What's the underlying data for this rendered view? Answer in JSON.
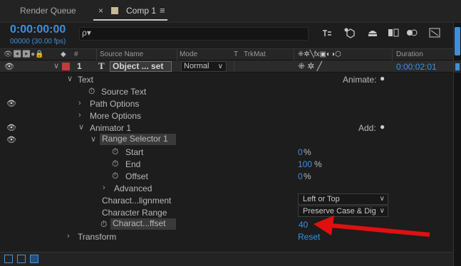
{
  "tabs": {
    "render_queue": "Render Queue",
    "comp": "Comp 1",
    "close": "×",
    "menu": "≡"
  },
  "timecode": {
    "time": "0:00:00:00",
    "frames": "00000 (30.00 fps)"
  },
  "search": {
    "glyph": "ρ▾"
  },
  "toolbar": {
    "icons": [
      "graph-editor-icon",
      "draft-3d-icon",
      "hide-shy-icon",
      "frame-blend-icon",
      "motion-blur-icon",
      "graph-icon"
    ]
  },
  "header": {
    "source_name": "Source Name",
    "mode": "Mode",
    "t": "T",
    "trkmat": "TrkMat",
    "duration": "Duration",
    "num": "#"
  },
  "layer": {
    "number": "1",
    "type": "T",
    "name": "Object ... set",
    "mode": "Normal",
    "duration": "0:00:02:01"
  },
  "rows": {
    "text": "Text",
    "animate": "Animate:",
    "source_text": "Source Text",
    "path_options": "Path Options",
    "more_options": "More Options",
    "animator": "Animator 1",
    "add": "Add:",
    "range_selector": "Range Selector 1",
    "start": "Start",
    "start_val": "0",
    "end": "End",
    "end_val": "100",
    "offset": "Offset",
    "offset_val": "0",
    "pct": "%",
    "advanced": "Advanced",
    "char_alignment": "Charact...lignment",
    "char_alignment_val": "Left or Top",
    "char_range": "Character Range",
    "char_range_val": "Preserve Case & Dig",
    "char_offset": "Charact...ffset",
    "char_offset_val": "40",
    "transform": "Transform",
    "reset": "Reset"
  },
  "colors": {
    "accent": "#3d8fde",
    "label": "#c23b3b",
    "annotation_arrow": "#e01010"
  }
}
